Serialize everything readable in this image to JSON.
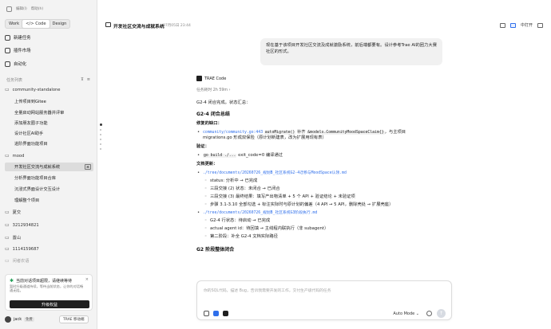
{
  "topbar": {
    "items": [
      "编辑(l)",
      "帮助(h)"
    ]
  },
  "mode_tabs": [
    "Work",
    "</> Code",
    "Design"
  ],
  "nav": {
    "new_task": "新建任务",
    "plugins": "插件市场",
    "automation": "自动化"
  },
  "task_list": {
    "label": "任务列表",
    "groups": [
      {
        "name": "community-standalone",
        "items": [
          "上传项目到Gitee",
          "全量启动网站服务器并评审",
          "添加朋友圈子功能",
          "设计社区AI助手",
          "进阶界面功能项目"
        ]
      },
      {
        "name": "mood",
        "items": [
          "开发社区交流与成就系统",
          "分析界面功能项目合库",
          "沉浸式界面设计交互设计",
          "理解整个项目"
        ]
      }
    ],
    "other_groups": [
      "夏交",
      "3212934821",
      "置山",
      "1114159687",
      "闲者农语"
    ],
    "active_icon": "⌘"
  },
  "upgrade": {
    "title": "当前对话项目超限，请继续等待",
    "desc": "暂时升级通道持续，等待当前状态，让你的对话畅通无阻。",
    "button": "升级权益",
    "close": "×"
  },
  "user": {
    "name": "jack",
    "badge": "免费",
    "trae_button": "TRAE 移动端"
  },
  "header": {
    "title": "开发社区交流与成就系统",
    "time": "07月05日 23:44",
    "open_label": "中打开"
  },
  "user_message": "现在基于该项目开发社区交流及成就激励系统，前后端都要有。设计参考Trae AI的团力大赛社区的形式。",
  "bot": {
    "name": "TRAE Code",
    "task_info": "任务耗时 2h 59m ›"
  },
  "response": {
    "status_line": "G2-4 闭合完成。状态汇总：",
    "h_summary": "G2-4 闭合总结",
    "fix_label": "修复的缺口：",
    "fix_code": "community/community.go:443",
    "fix_code2": "autoMigrate()",
    "fix_text1": " 补齐 ",
    "fix_code3": "&models.CommunityMoodSpaceClaim{}",
    "fix_text2": "，与主项目",
    "fix_text3": "migrations.go 形成双保险（原计划新建表，改为扩展用现有表）",
    "verify_label": "验证：",
    "verify_code": "go build ./...",
    "verify_text": " exit_code=0 编译通过",
    "doc_label": "文档更新：",
    "doc1_link": "./tree/documents/20260726_规划B_社区系统G2-4迁移与MoodSpace认领.md",
    "doc1_subs": [
      "status: 分析中 → 已完成",
      "三段交接 (2) 状态：未闭合 → 已闭合",
      "三段交接 (3) 最终结果：填写产出物清单 + 5 个 API + 验证结论 + 未验证项",
      "步骤 3.1-3.10 全部勾选 + 标注实际时与原计划的偏差（4 API → 5 API，删除壳处 → 扩展壳座）"
    ],
    "doc2_link": "./tree/documents/20260726_规划B_社区系统G3阶段执行.md",
    "doc2_subs": [
      "G2-4 行状态：待启动 → 已完成",
      "actual agent id：待回填 → 主线程内联执行（非 subagent）",
      "第二阶段：补全 G2-4 文档实际路径"
    ],
    "h_next": "G2 阶段整体闭合"
  },
  "composer": {
    "placeholder": "你的SQL代码，描述 Bug，告诉我需要开发的工作，交付生产级代码的任务",
    "mode": "Auto Mode ⌄",
    "send": "↑"
  }
}
